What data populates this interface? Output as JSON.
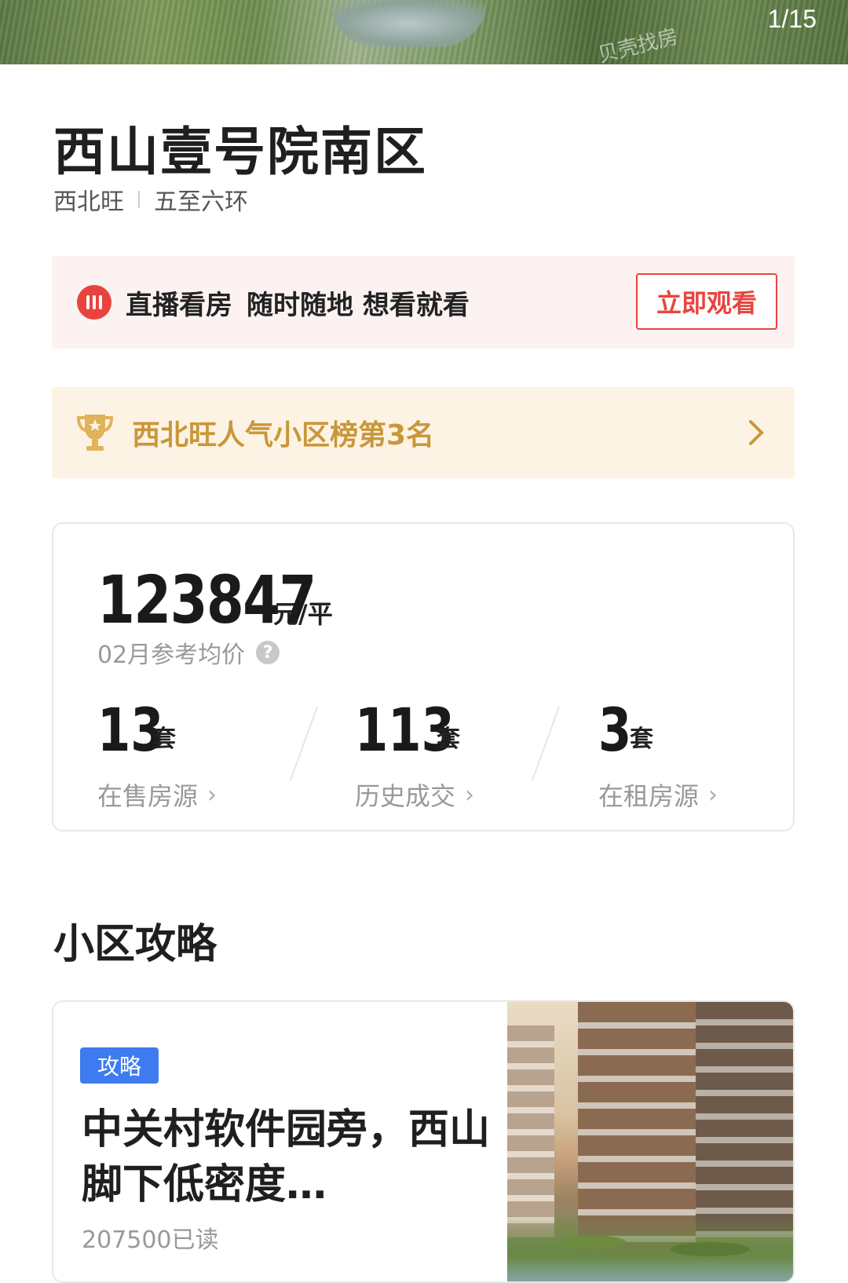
{
  "hero": {
    "counter": "1/15",
    "watermark": "贝壳找房"
  },
  "community": {
    "name": "西山壹号院南区",
    "area": "西北旺",
    "ring": "五至六环"
  },
  "live_banner": {
    "title": "直播看房",
    "subtitle": "随时随地 想看就看",
    "button": "立即观看"
  },
  "ranking": {
    "text": "西北旺人气小区榜第3名"
  },
  "stats": {
    "price": "123847",
    "price_unit": "元/平",
    "price_label": "02月参考均价",
    "help_icon": "?",
    "items": [
      {
        "value": "13",
        "unit": "套",
        "label": "在售房源"
      },
      {
        "value": "113",
        "unit": "套",
        "label": "历史成交"
      },
      {
        "value": "3",
        "unit": "套",
        "label": "在租房源"
      }
    ]
  },
  "guide": {
    "section_title": "小区攻略",
    "tag": "攻略",
    "headline": "中关村软件园旁，西山脚下低密度…",
    "reads": "207500已读"
  },
  "colors": {
    "accent_red": "#e8443f",
    "gold": "#c9973a",
    "tag_blue": "#3e7bf0"
  }
}
